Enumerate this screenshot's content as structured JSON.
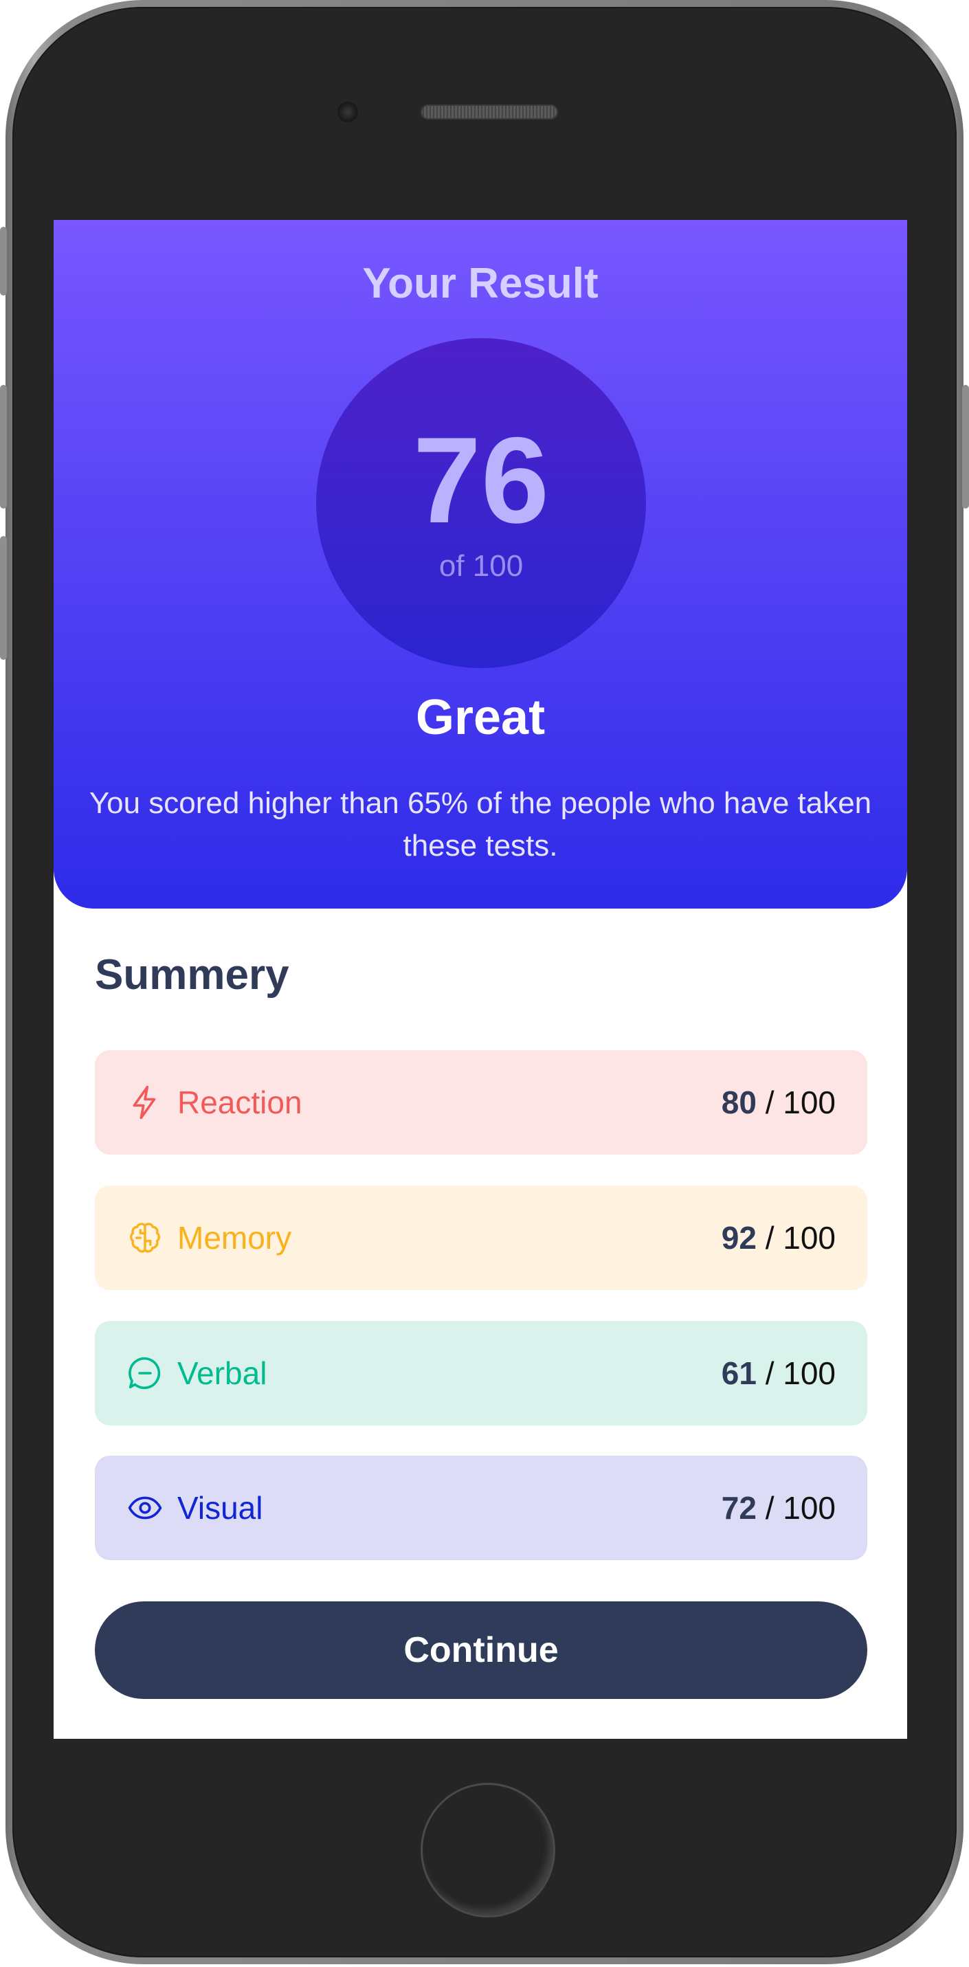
{
  "result": {
    "heading": "Your Result",
    "score": "76",
    "score_max": "of 100",
    "rating": "Great",
    "description": "You scored higher than 65% of the people who have taken these tests."
  },
  "summary": {
    "title": "Summery",
    "items": [
      {
        "label": "Reaction",
        "score": "80",
        "max": "/ 100",
        "icon": "lightning-icon",
        "color": "#f25a5a",
        "bg": "#fde5e5"
      },
      {
        "label": "Memory",
        "score": "92",
        "max": "/ 100",
        "icon": "brain-icon",
        "color": "#f9b21c",
        "bg": "#fff2de"
      },
      {
        "label": "Verbal",
        "score": "61",
        "max": "/ 100",
        "icon": "chat-bubble-icon",
        "color": "#00bb8f",
        "bg": "#d9f3ec"
      },
      {
        "label": "Visual",
        "score": "72",
        "max": "/ 100",
        "icon": "eye-icon",
        "color": "#1125d4",
        "bg": "#dcdcf7"
      }
    ]
  },
  "actions": {
    "continue_label": "Continue"
  },
  "colors": {
    "gradient_top": "#7857ff",
    "gradient_bottom": "#2e2be9",
    "dark_slate": "#303b5a"
  }
}
